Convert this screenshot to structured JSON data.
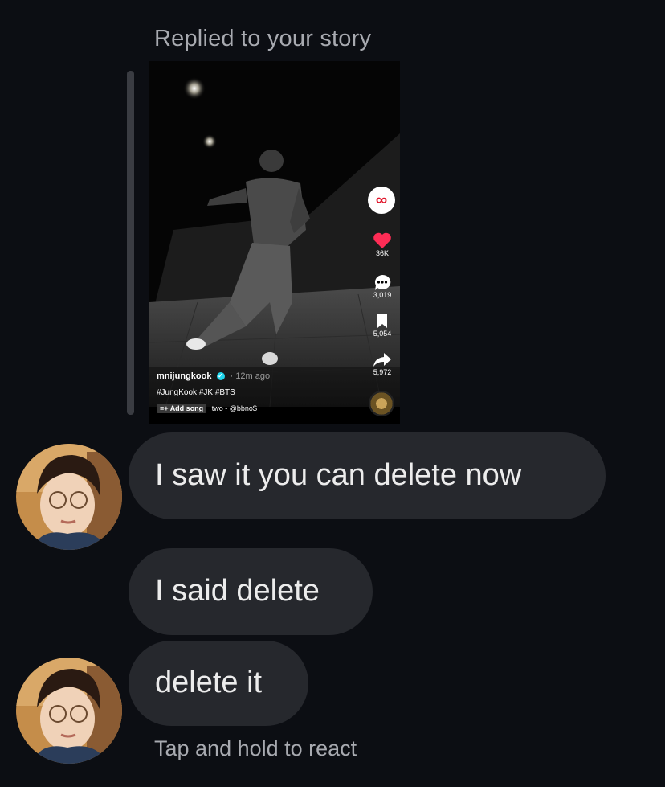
{
  "thread": {
    "reply_header": "Replied to your story",
    "hint": "Tap and hold to react"
  },
  "story": {
    "username": "mnijungkook",
    "time": "12m ago",
    "hashtags": "#JungKook #JK #BTS",
    "add_song_label": "Add song",
    "song": "two - @bbno$",
    "likes": "36K",
    "comments": "3,019",
    "saves": "5,054",
    "shares": "5,972",
    "brand_icon": "swirl-logo-icon"
  },
  "messages": [
    {
      "text": "I saw it you can delete now"
    },
    {
      "text": "I said delete"
    },
    {
      "text": "delete it"
    }
  ],
  "colors": {
    "background": "#0c0e13",
    "bubble": "#26282d",
    "muted_text": "#a8aab0",
    "like_red": "#fe2c55"
  }
}
